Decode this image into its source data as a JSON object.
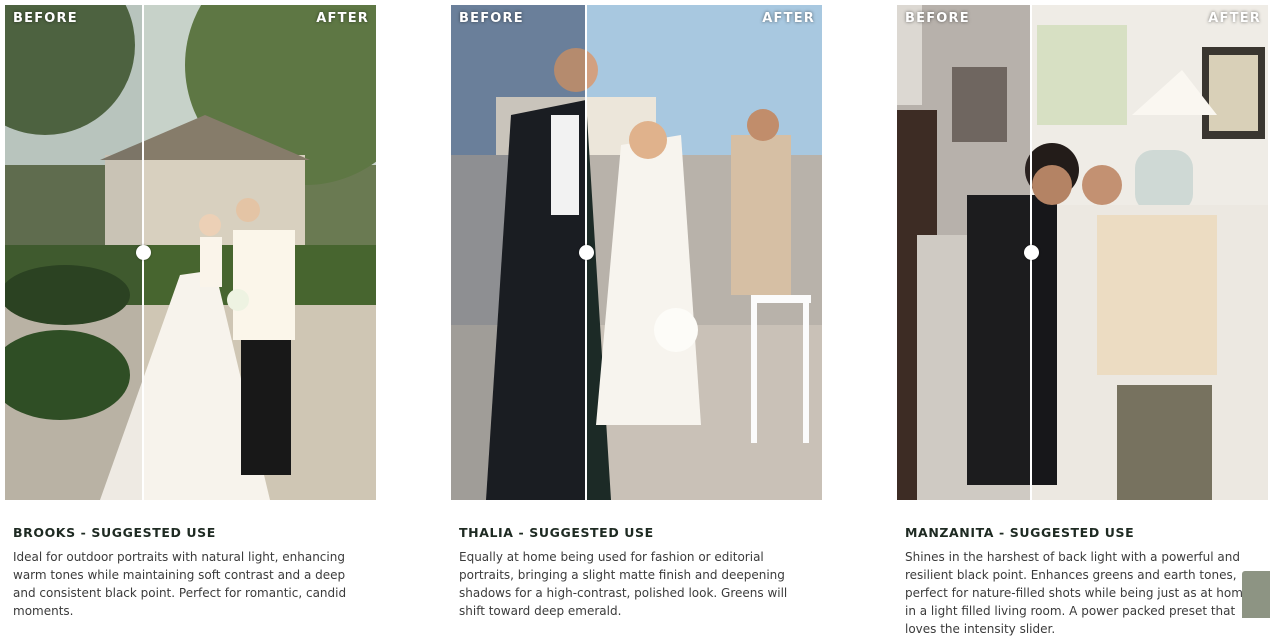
{
  "compare_labels": {
    "before": "BEFORE",
    "after": "AFTER"
  },
  "presets": [
    {
      "title": "BROOKS - SUGGESTED USE",
      "description": "Ideal for outdoor portraits with natural light, enhancing warm tones while maintaining soft contrast and a deep and consistent black point. Perfect for romantic, candid moments.",
      "slider_position": 0.373
    },
    {
      "title": "THALIA - SUGGESTED USE",
      "description": "Equally at home being used for fashion or editorial portraits, bringing a slight matte finish and deepening shadows for a high-contrast, polished look. Greens will shift toward deep emerald.",
      "slider_position": 0.363
    },
    {
      "title": "MANZANITA - SUGGESTED USE",
      "description": "Shines in the harshest of back light with a powerful and resilient black point. Enhances greens and earth tones, perfect for nature-filled shots while being just as at home in a light filled living room. A power packed preset that loves the intensity slider.",
      "slider_position": 0.36
    }
  ],
  "colors": {
    "heading": "#1e2a22",
    "body_text": "#3b3b3b",
    "side_tab": "#8d9483"
  }
}
